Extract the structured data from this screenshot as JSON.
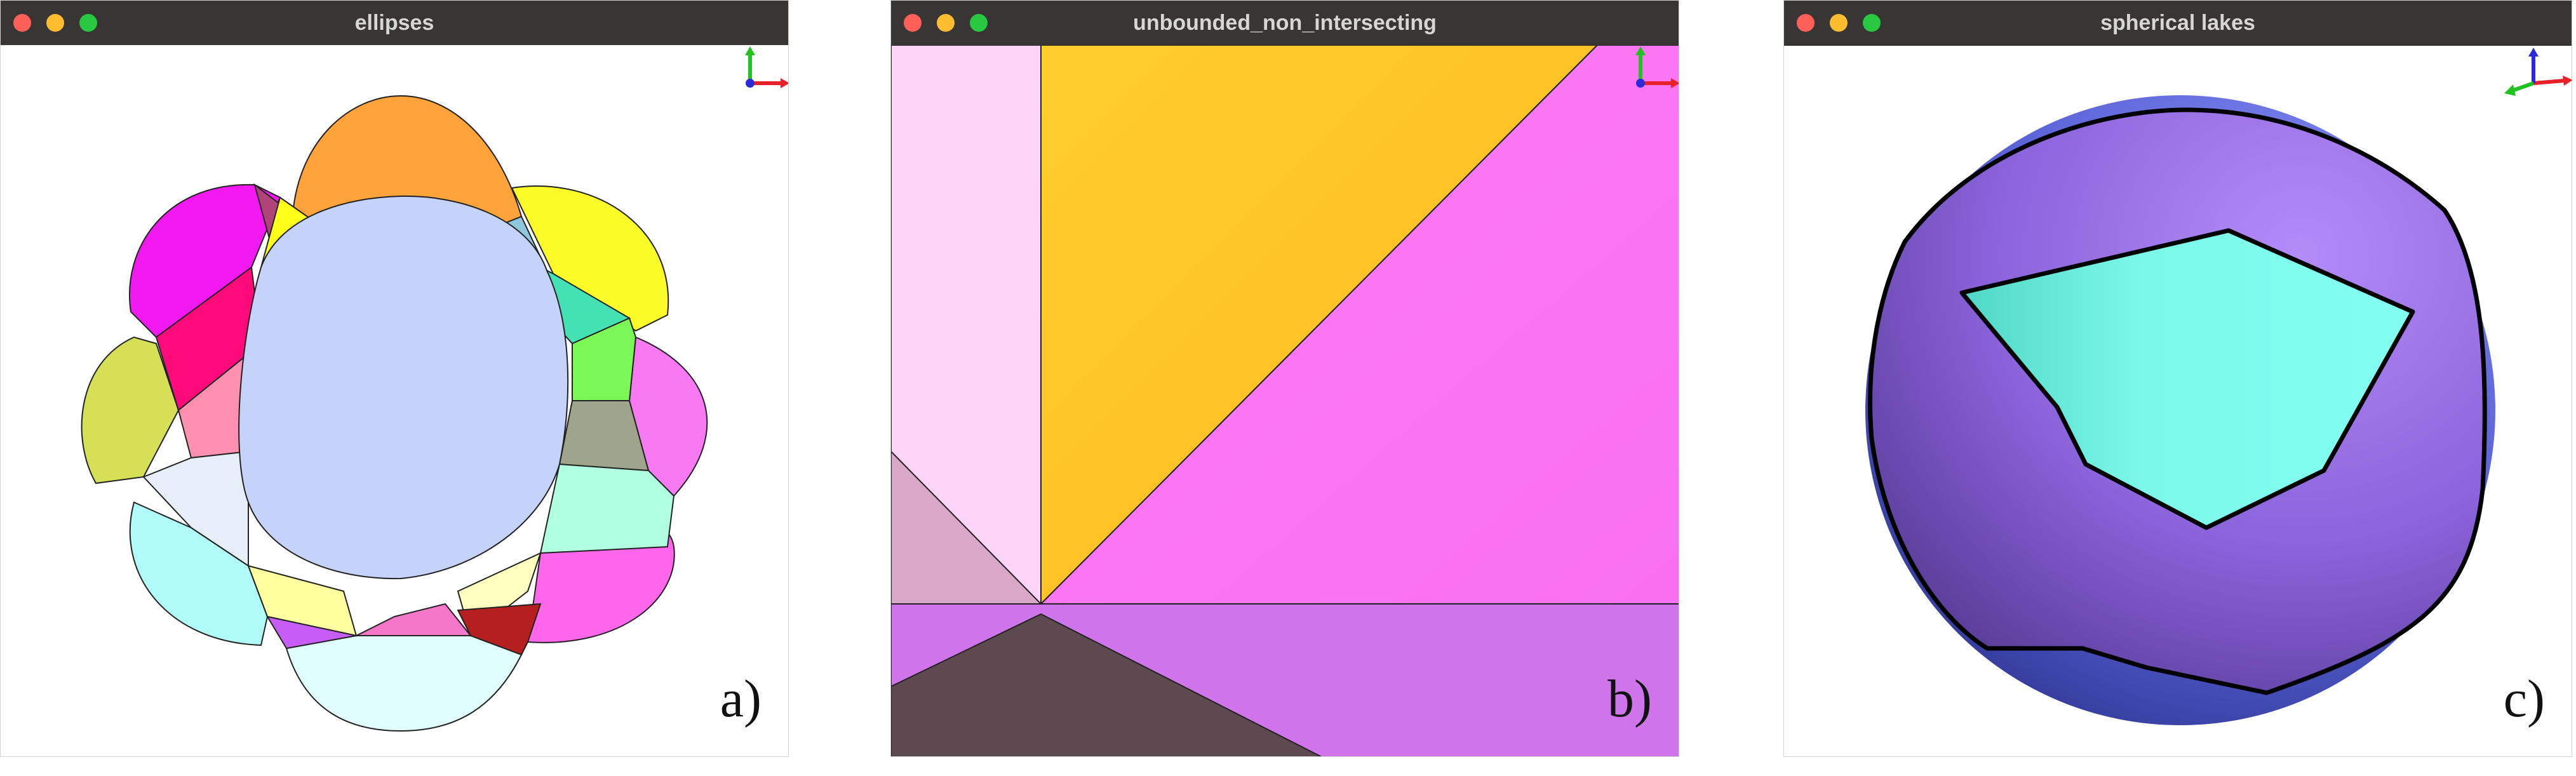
{
  "windows": [
    {
      "id": "a",
      "title": "ellipses",
      "panel_label": "a)"
    },
    {
      "id": "b",
      "title": "unbounded_non_intersecting",
      "panel_label": "b)"
    },
    {
      "id": "c",
      "title": "spherical lakes",
      "panel_label": "c)"
    }
  ],
  "icons": {
    "window_close": "close-button-icon",
    "window_minimize": "minimize-button-icon",
    "window_maximize": "maximize-button-icon",
    "axes_gizmo": "axes-gizmo-icon"
  },
  "colors": {
    "titlebar": "#383535",
    "title_text": "#d6d6d6",
    "close": "#fe5f57",
    "minimize": "#febc2e",
    "maximize": "#28c840",
    "axis_x": "#e8202a",
    "axis_y": "#1fc21f",
    "axis_z": "#2a2ad8"
  }
}
